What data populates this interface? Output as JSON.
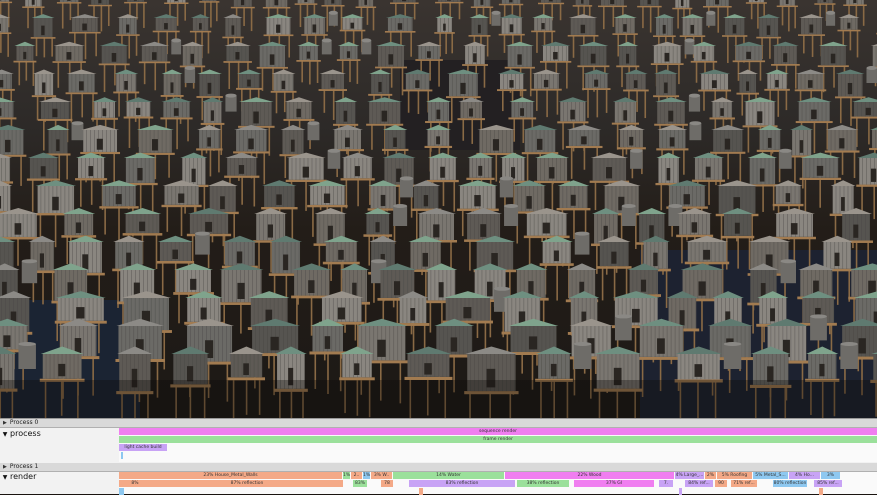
{
  "viewport": {
    "description_icon": "render-viewport-image"
  },
  "profiler": {
    "process0": {
      "header": "Process 0",
      "row_label": "process",
      "bars": [
        {
          "label": "sequence render",
          "color": "#f07ef0"
        },
        {
          "label": "frame render",
          "color": "#9be09b"
        },
        {
          "label": "light cache build",
          "color": "#c8a3f5"
        }
      ]
    },
    "process1": {
      "header": "Process 1",
      "row_label": "render",
      "top_bars": [
        {
          "label": "23% House_Metal_Walls",
          "color": "#f4a987"
        },
        {
          "label": "1%",
          "color": "#9be09b"
        },
        {
          "label": "2..",
          "color": "#f4a987"
        },
        {
          "label": "1%",
          "color": "#8ec8f0"
        },
        {
          "label": "3% W..",
          "color": "#f4a987"
        },
        {
          "label": "14% Water",
          "color": "#9be09b"
        },
        {
          "label": "22% Wood",
          "color": "#f07ef0"
        },
        {
          "label": "4% Large_...",
          "color": "#c8a3f5"
        },
        {
          "label": "2%",
          "color": "#f4a987"
        },
        {
          "label": "5% Roofing",
          "color": "#f4a987"
        },
        {
          "label": "5% Metal_S...",
          "color": "#8ec8f0"
        },
        {
          "label": "4% Ho...",
          "color": "#c8a3f5"
        },
        {
          "label": "3%",
          "color": "#8ec8f0"
        }
      ],
      "bottom_bars": [
        {
          "label": "8%",
          "color": "#f4a987"
        },
        {
          "label": "87% reflection",
          "color": "#f4a987"
        },
        {
          "label": "83%",
          "color": "#9be09b"
        },
        {
          "label": "78",
          "color": "#f4a987"
        },
        {
          "label": "83% reflection",
          "color": "#c8a3f5"
        },
        {
          "label": "38% reflection",
          "color": "#9be09b"
        },
        {
          "label": "37% GI",
          "color": "#f07ef0"
        },
        {
          "label": "7.",
          "color": "#c8a3f5"
        },
        {
          "label": "84% ref...",
          "color": "#c8a3f5"
        },
        {
          "label": "90",
          "color": "#f4a987"
        },
        {
          "label": "71% ref...",
          "color": "#f4a987"
        },
        {
          "label": "80% reflection",
          "color": "#8ec8f0"
        },
        {
          "label": "85% ref...",
          "color": "#c8a3f5"
        }
      ]
    }
  }
}
